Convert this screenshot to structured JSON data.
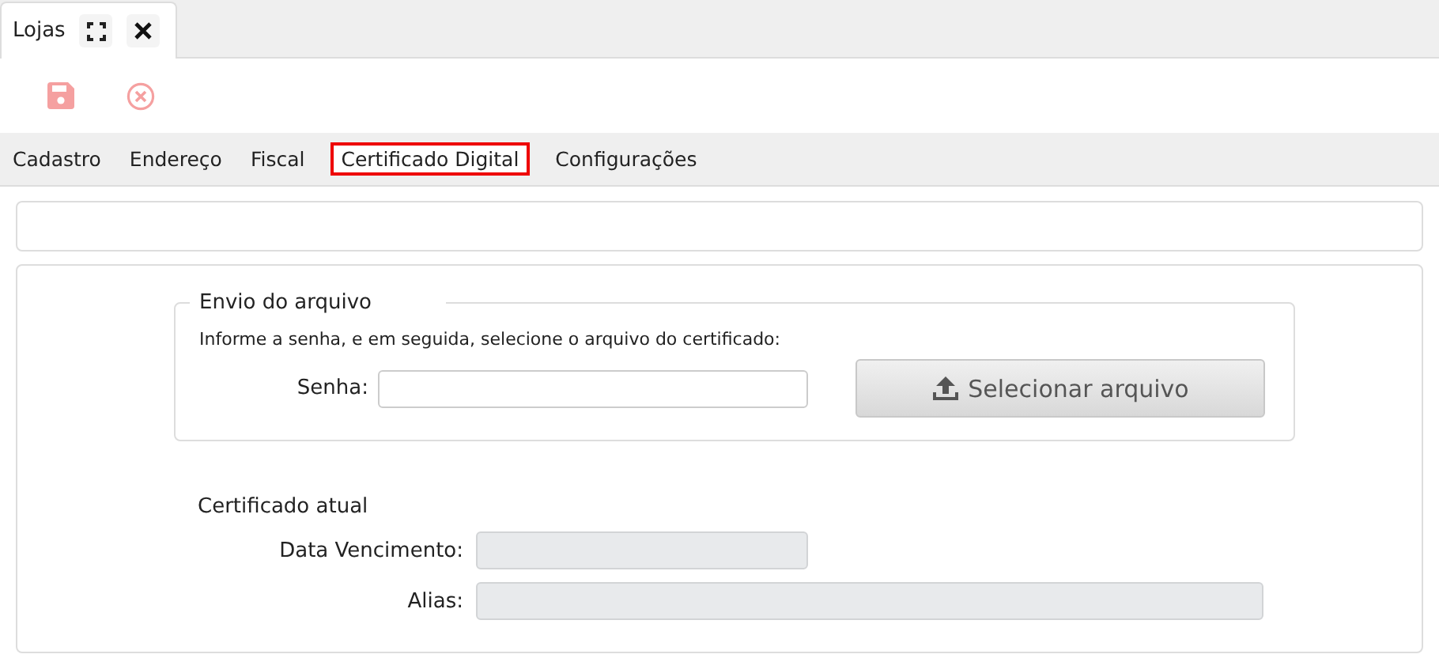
{
  "doc_tab": {
    "title": "Lojas"
  },
  "toolbar": [
    {
      "kind": "save",
      "disabled": true
    },
    {
      "kind": "cancel",
      "disabled": true
    }
  ],
  "tabs": [
    {
      "label": "Cadastro",
      "selected": false
    },
    {
      "label": "Endereço",
      "selected": false
    },
    {
      "label": "Fiscal",
      "selected": false
    },
    {
      "label": "Certificado Digital",
      "selected": true
    },
    {
      "label": "Configurações",
      "selected": false
    }
  ],
  "upload": {
    "legend": "Envio do arquivo",
    "instructions": "Informe a senha, e em seguida, selecione o arquivo do certificado:",
    "password_label": "Senha:",
    "button": "Selecionar arquivo"
  },
  "current": {
    "heading": "Certificado atual",
    "fields": [
      {
        "label": "Data Vencimento:",
        "disabled": true
      },
      {
        "label": "Alias:",
        "disabled": true
      }
    ]
  }
}
